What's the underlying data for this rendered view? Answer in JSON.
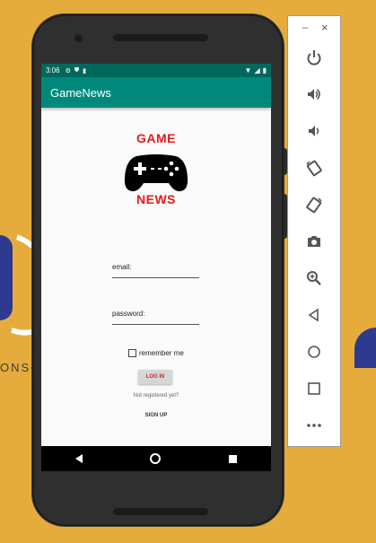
{
  "background": {
    "partial_text": "ONSO"
  },
  "statusbar": {
    "time": "3:06"
  },
  "app": {
    "title": "GameNews"
  },
  "logo": {
    "top_text": "GAME",
    "bottom_text": "NEWS"
  },
  "form": {
    "email_label": "email:",
    "password_label": "password:",
    "remember_label": "remember me",
    "login_label": "LOG IN",
    "not_registered": "Not registered yet?",
    "signup_label": "SIGN UP"
  },
  "emulator_toolbar": {
    "icons": [
      "power-icon",
      "volume-up-icon",
      "volume-down-icon",
      "rotate-left-icon",
      "rotate-right-icon",
      "camera-icon",
      "zoom-icon",
      "back-icon",
      "home-icon",
      "overview-icon",
      "more-icon"
    ]
  },
  "colors": {
    "primary": "#00897b",
    "primary_dark": "#00695c",
    "accent": "#e31b1b",
    "page_background": "#e5ac3d"
  }
}
